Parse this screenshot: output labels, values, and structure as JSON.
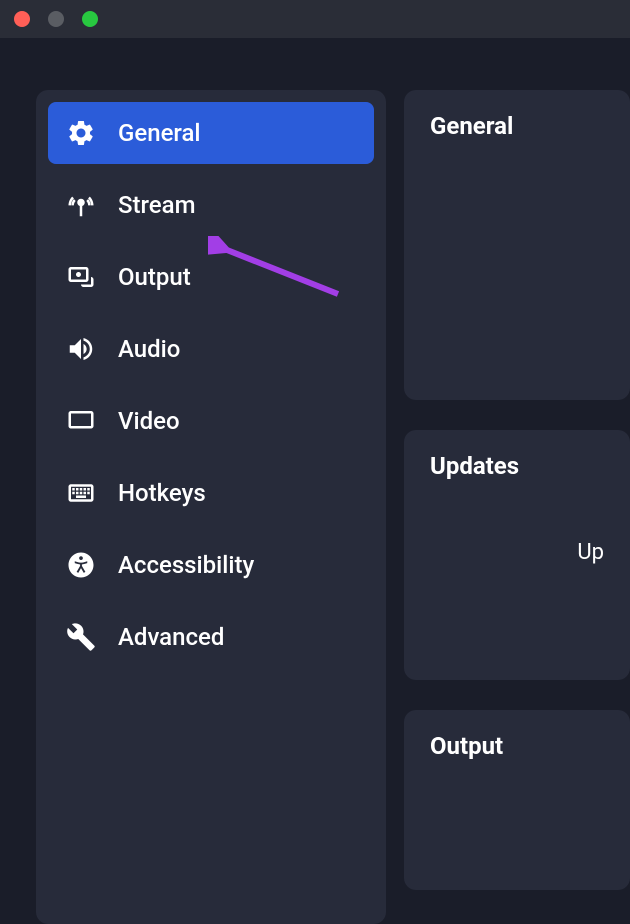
{
  "sidebar": {
    "items": [
      {
        "label": "General",
        "icon": "gear-icon",
        "active": true
      },
      {
        "label": "Stream",
        "icon": "antenna-icon",
        "active": false
      },
      {
        "label": "Output",
        "icon": "output-icon",
        "active": false
      },
      {
        "label": "Audio",
        "icon": "speaker-icon",
        "active": false
      },
      {
        "label": "Video",
        "icon": "display-icon",
        "active": false
      },
      {
        "label": "Hotkeys",
        "icon": "keyboard-icon",
        "active": false
      },
      {
        "label": "Accessibility",
        "icon": "accessibility-icon",
        "active": false
      },
      {
        "label": "Advanced",
        "icon": "tools-icon",
        "active": false
      }
    ]
  },
  "panels": {
    "general": {
      "title": "General"
    },
    "updates": {
      "title": "Updates",
      "body": "Up"
    },
    "output": {
      "title": "Output"
    }
  },
  "annotation": {
    "arrow_color": "#a23ee6"
  }
}
